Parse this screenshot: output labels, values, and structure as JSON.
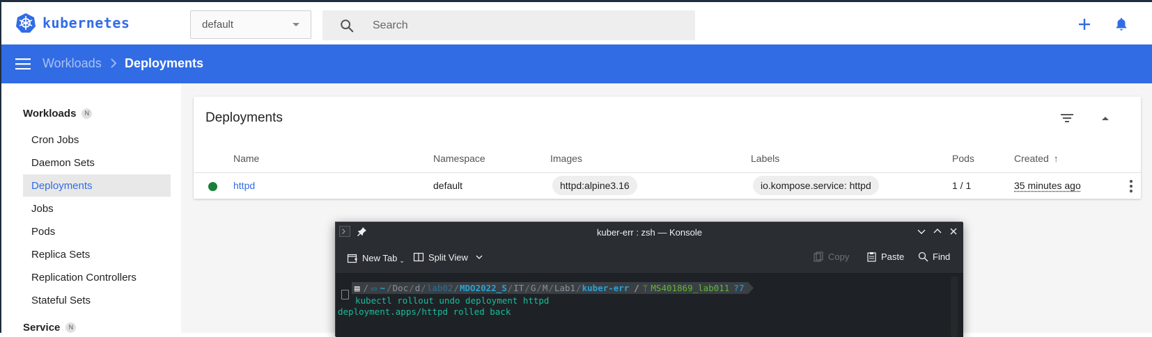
{
  "header": {
    "logo_text": "kubernetes",
    "namespace_value": "default",
    "search_placeholder": "Search",
    "accent": "#326ce5"
  },
  "breadcrumb": {
    "parent": "Workloads",
    "current": "Deployments"
  },
  "sidebar": {
    "sections": [
      {
        "label": "Workloads",
        "badge": "N"
      },
      {
        "label": "Service",
        "badge": "N"
      }
    ],
    "items": [
      {
        "label": "Cron Jobs"
      },
      {
        "label": "Daemon Sets"
      },
      {
        "label": "Deployments",
        "active": true
      },
      {
        "label": "Jobs"
      },
      {
        "label": "Pods"
      },
      {
        "label": "Replica Sets"
      },
      {
        "label": "Replication Controllers"
      },
      {
        "label": "Stateful Sets"
      }
    ]
  },
  "deployments": {
    "title": "Deployments",
    "columns": [
      "Name",
      "Namespace",
      "Images",
      "Labels",
      "Pods",
      "Created"
    ],
    "sort_indicator": "↑",
    "rows": [
      {
        "status": "running",
        "name": "httpd",
        "namespace": "default",
        "image": "httpd:alpine3.16",
        "label": "io.kompose.service: httpd",
        "pods": "1 / 1",
        "created": "35 minutes ago"
      }
    ]
  },
  "konsole": {
    "title": "kuber-err : zsh — Konsole",
    "toolbar": {
      "new_tab": "New Tab",
      "split_view": "Split View",
      "copy": "Copy",
      "paste": "Paste",
      "find": "Find"
    },
    "prompt": {
      "home": "~",
      "p1": "Doc",
      "p2": "d",
      "p3": "lab02",
      "p4": "MDO2022_S",
      "p5": "IT",
      "p6": "G",
      "p7": "M",
      "p8": "Lab1",
      "p9": "kuber-err",
      "branch": "MS401869_lab011",
      "git_status": "?7"
    },
    "command": "kubectl rollout undo deployment httpd",
    "output": "deployment.apps/httpd rolled back"
  }
}
